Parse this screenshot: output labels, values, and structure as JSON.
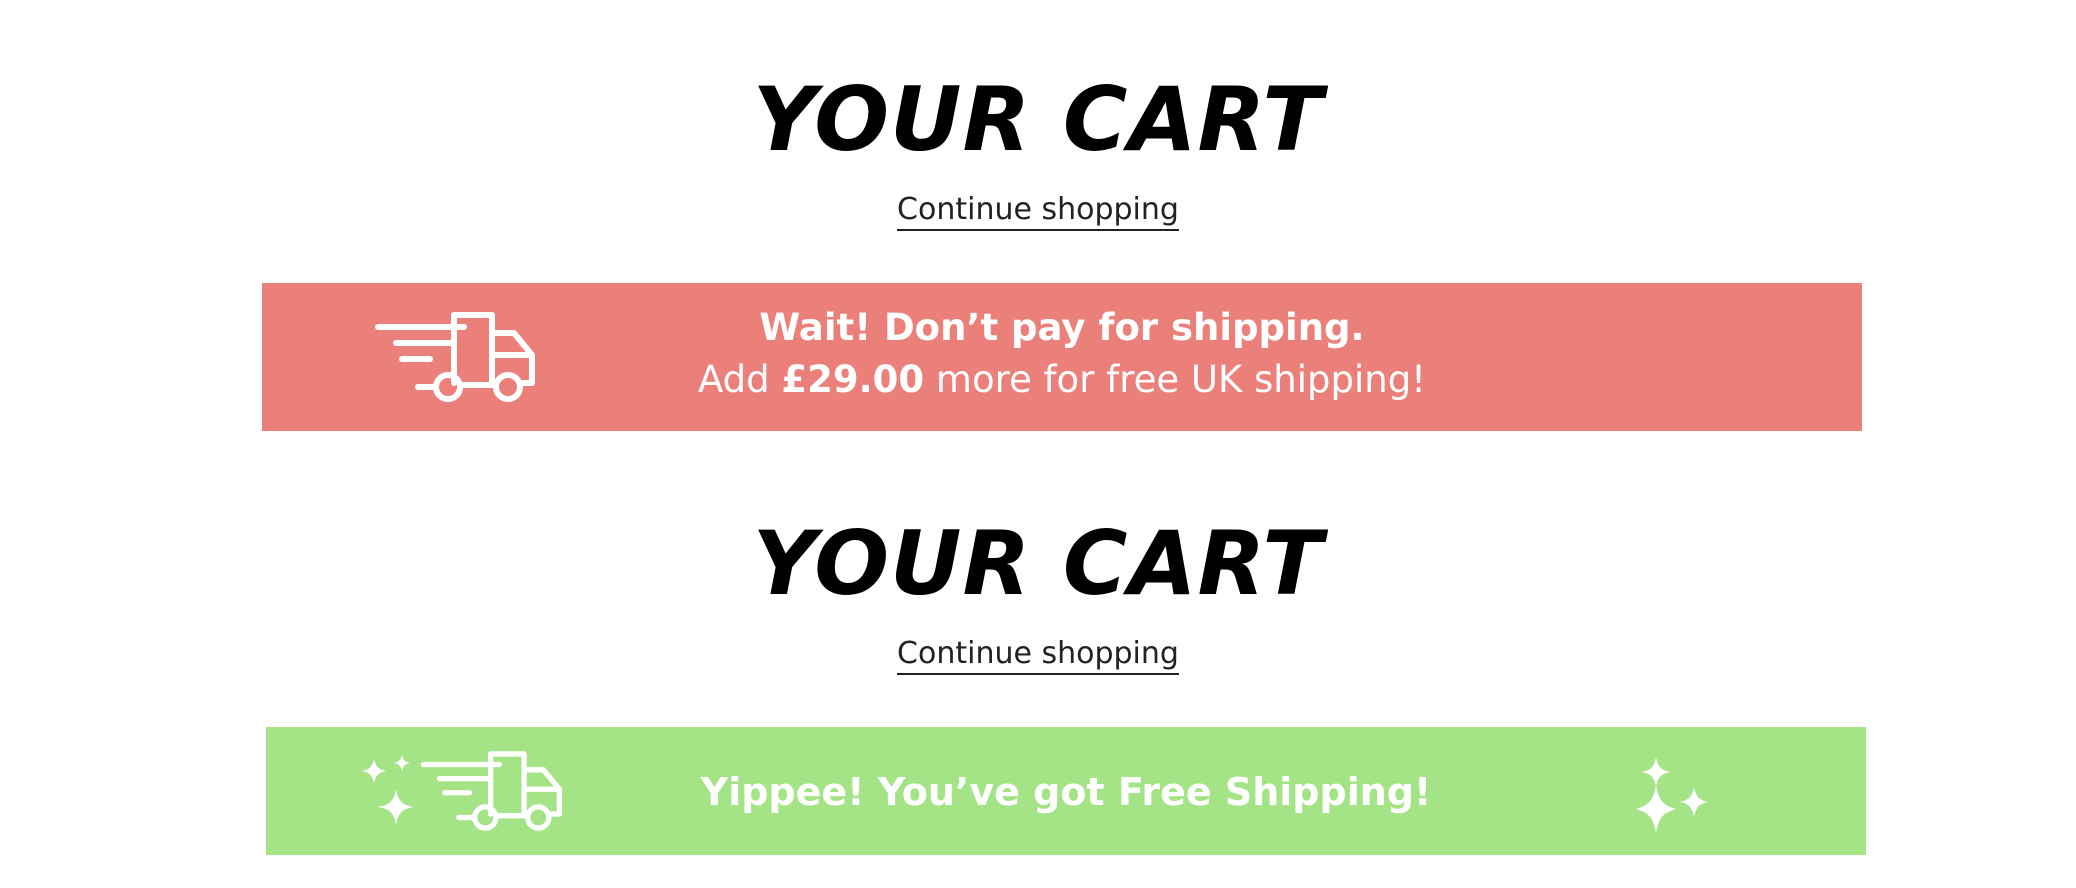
{
  "cart_section_1": {
    "title": "YOUR CART",
    "continue_label": "Continue shopping",
    "banner": {
      "headline": "Wait! Don’t pay for shipping.",
      "prefix": "Add",
      "amount": "£29.00",
      "suffix": "more for free UK shipping!",
      "icon": "delivery-truck-icon",
      "background": "#EB807B"
    }
  },
  "cart_section_2": {
    "title": "YOUR CART",
    "continue_label": "Continue shopping",
    "banner": {
      "headline": "Yippee! You’ve got Free Shipping!",
      "icons": [
        "sparkle-icon",
        "delivery-truck-icon",
        "sparkle-icon"
      ],
      "background": "#A4E487"
    }
  }
}
